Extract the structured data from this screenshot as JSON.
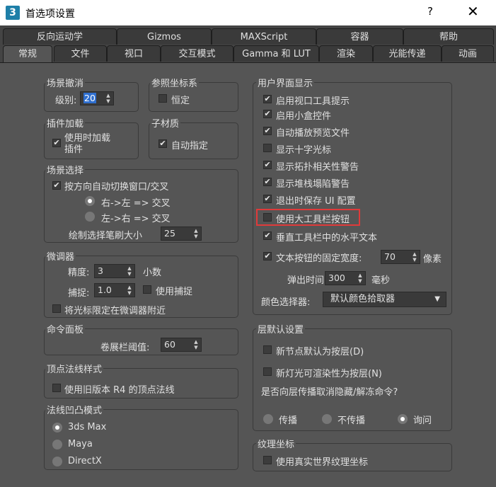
{
  "window": {
    "title": "首选项设置",
    "help": "?",
    "close": "✕",
    "logo": "3"
  },
  "tabs_row1": [
    "反向运动学",
    "Gizmos",
    "MAXScript",
    "容器",
    "帮助"
  ],
  "tabs_row2": [
    "常规",
    "文件",
    "视口",
    "交互模式",
    "Gamma 和 LUT",
    "渲染",
    "光能传递",
    "动画"
  ],
  "scene_undo": {
    "title": "场景撤消",
    "level_label": "级别:",
    "level_value": "20"
  },
  "ref_coord": {
    "title": "参照坐标系",
    "constant": "恒定"
  },
  "plugin_load": {
    "title": "插件加载",
    "load_on_use": "使用时加载插件"
  },
  "sub_material": {
    "title": "子材质",
    "auto_assign": "自动指定"
  },
  "scene_select": {
    "title": "场景选择",
    "auto_switch": "按方向自动切换窗口/交叉",
    "right_left": "右->左 => 交叉",
    "left_right": "左->右 => 交叉",
    "brush_size_label": "绘制选择笔刷大小",
    "brush_size_value": "25"
  },
  "spinner": {
    "title": "微调器",
    "precision_label": "精度:",
    "precision_value": "3",
    "decimals": "小数",
    "snap_label": "捕捉:",
    "snap_value": "1.0",
    "use_snap": "使用捕捉",
    "wrap_cursor": "将光标限定在微调器附近"
  },
  "command_panel": {
    "title": "命令面板",
    "rollup_label": "卷展栏阈值:",
    "rollup_value": "60"
  },
  "vertex_normal": {
    "title": "顶点法线样式",
    "legacy": "使用旧版本 R4 的顶点法线"
  },
  "bump_mode": {
    "title": "法线凹凸模式",
    "options": [
      "3ds Max",
      "Maya",
      "DirectX"
    ],
    "selected": "3ds Max"
  },
  "ui_display": {
    "title": "用户界面显示",
    "items": [
      {
        "label": "启用视口工具提示",
        "checked": true
      },
      {
        "label": "启用小盒控件",
        "checked": true
      },
      {
        "label": "自动播放预览文件",
        "checked": true
      },
      {
        "label": "显示十字光标",
        "checked": false
      },
      {
        "label": "显示拓扑相关性警告",
        "checked": true
      },
      {
        "label": "显示堆栈塌陷警告",
        "checked": true
      },
      {
        "label": "退出时保存 UI 配置",
        "checked": true
      },
      {
        "label": "使用大工具栏按钮",
        "checked": false
      },
      {
        "label": "垂直工具栏中的水平文本",
        "checked": true
      }
    ],
    "fixed_width_label": "文本按钮的固定宽度:",
    "fixed_width_value": "70",
    "pixels": "像素",
    "flyout_label": "弹出时间:",
    "flyout_value": "300",
    "ms": "毫秒",
    "color_picker_label": "颜色选择器:",
    "color_picker_value": "默认颜色拾取器"
  },
  "layer_defaults": {
    "title": "层默认设置",
    "new_nodes": "新节点默认为按层(D)",
    "new_lights": "新灯光可渲染性为按层(N)",
    "question": "是否向层传播取消隐藏/解冻命令?",
    "options": [
      "传播",
      "不传播",
      "询问"
    ],
    "selected": "询问"
  },
  "texture_coords": {
    "title": "纹理坐标",
    "real_world": "使用真实世界纹理坐标"
  }
}
